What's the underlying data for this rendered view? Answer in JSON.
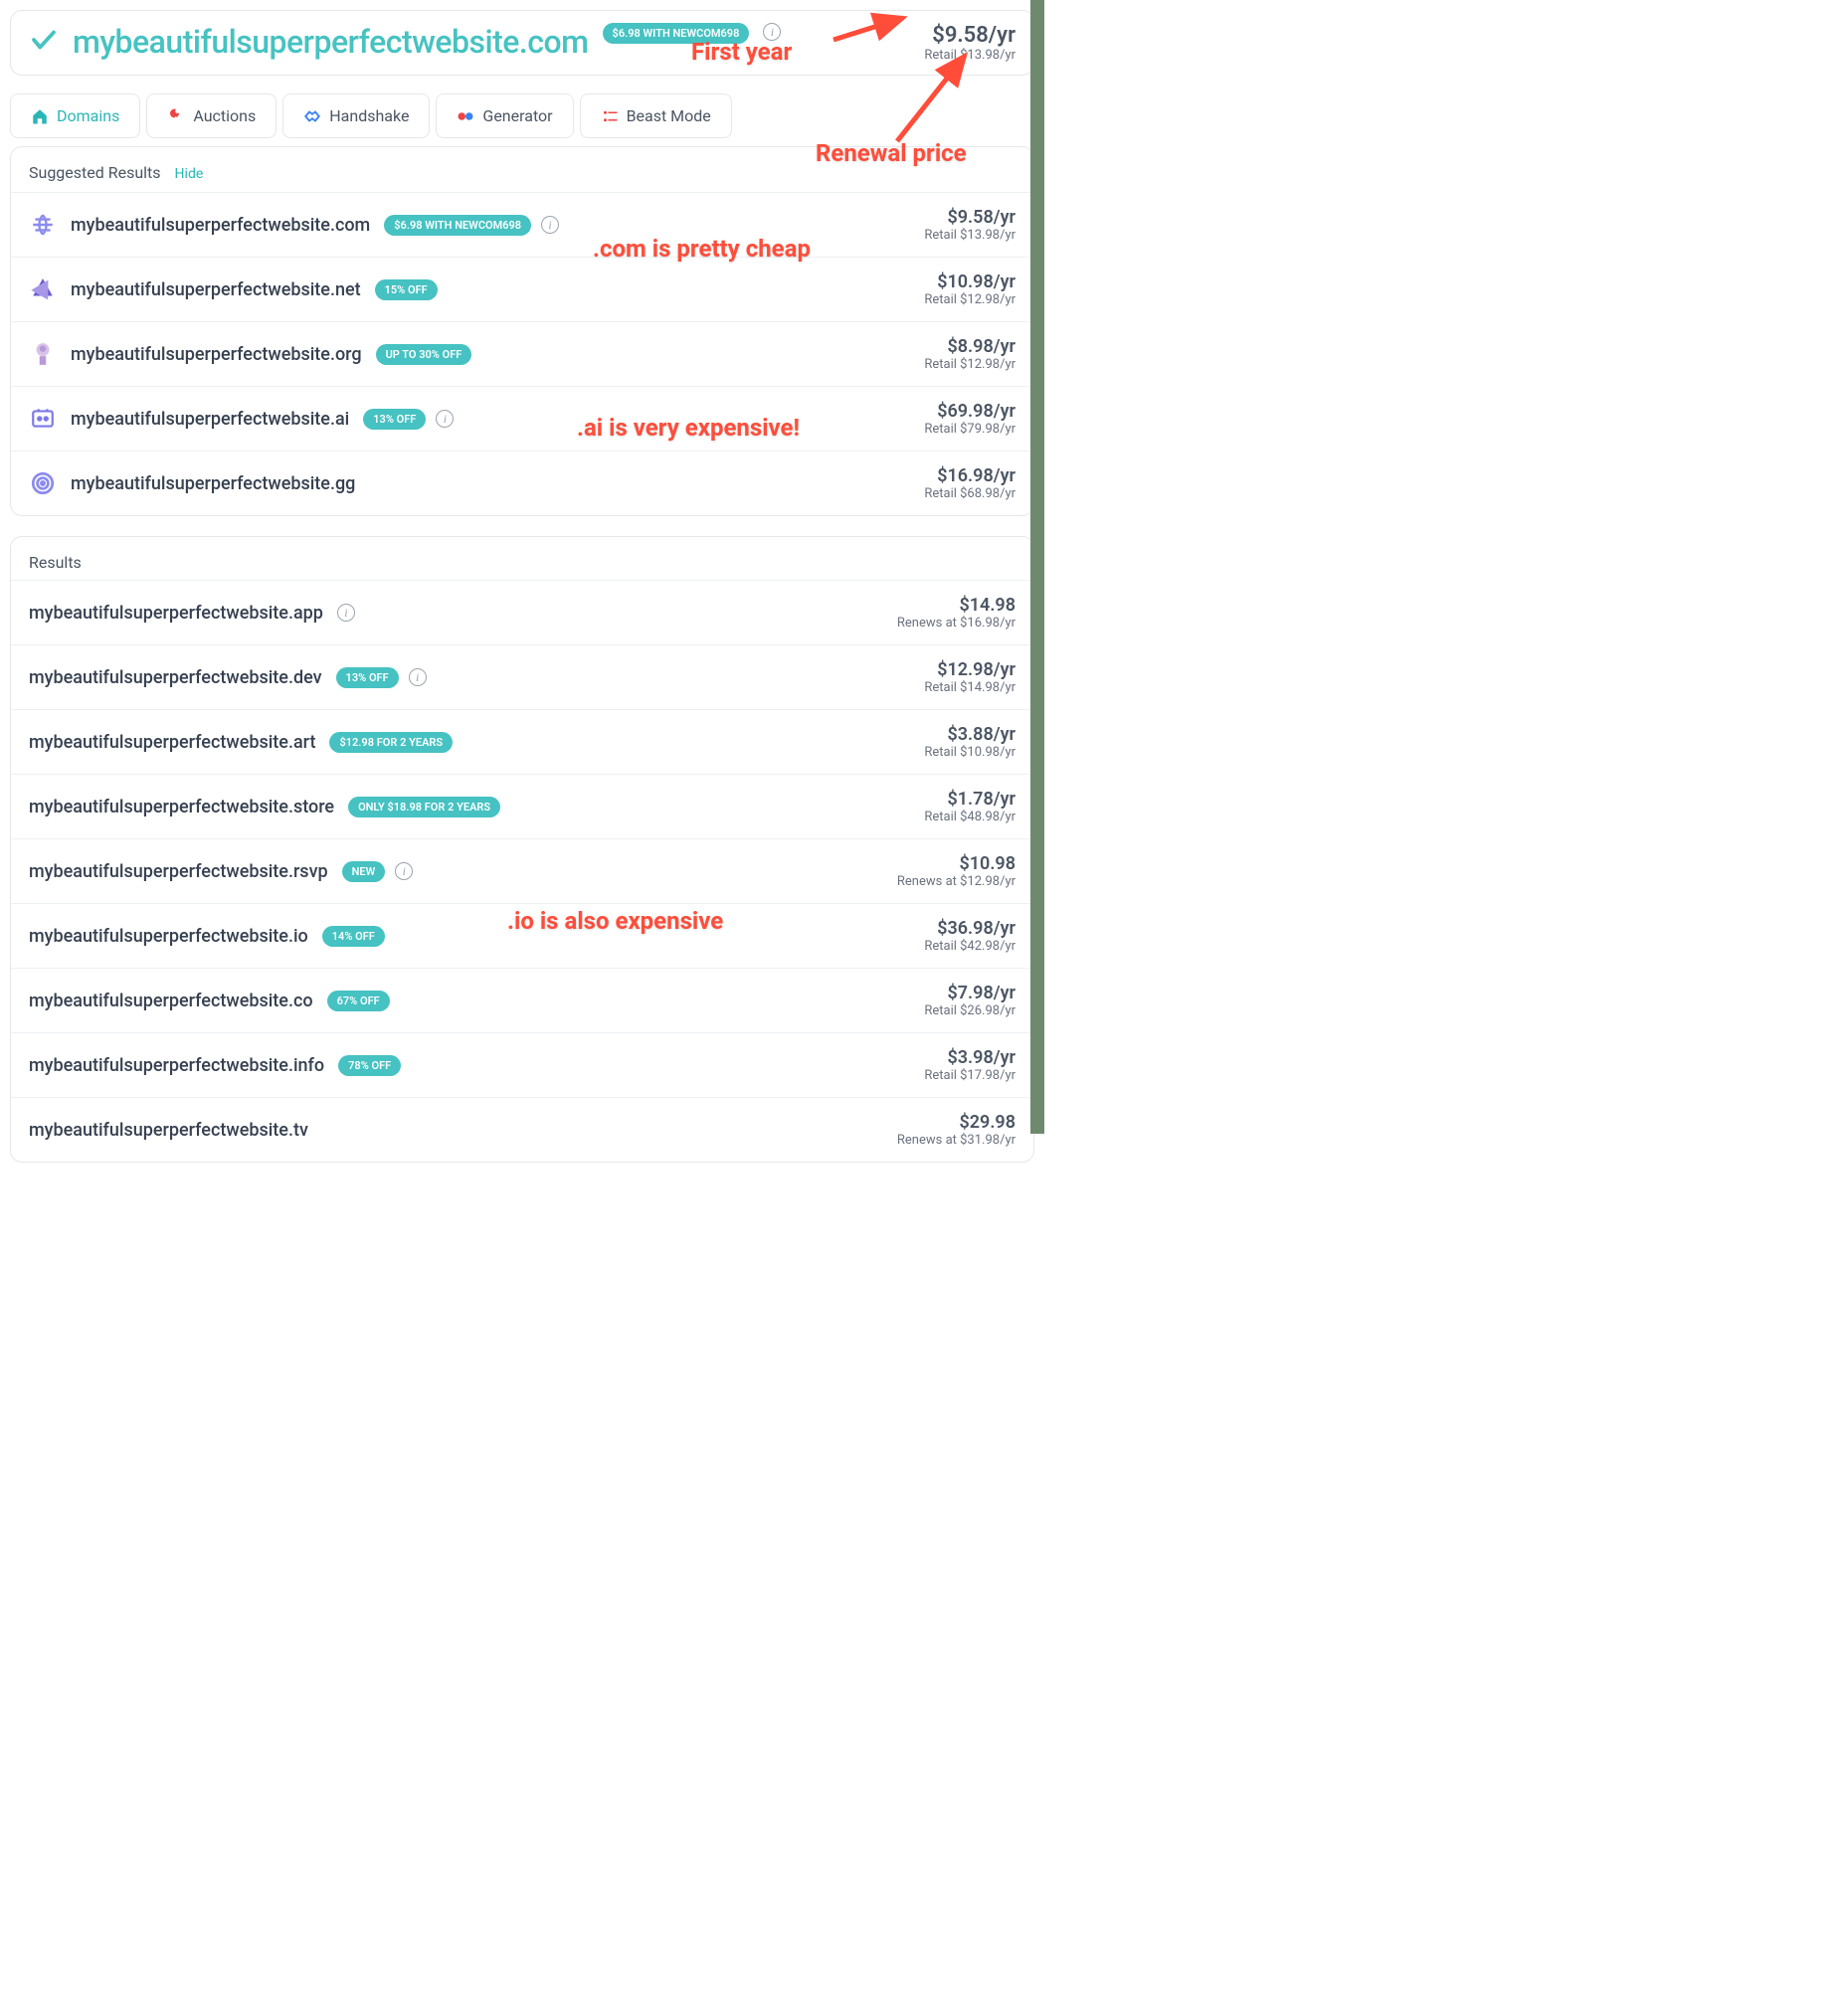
{
  "header": {
    "domain": "mybeautifulsuperperfectwebsite.com",
    "promo": "$6.98 WITH NEWCOM698",
    "price": "$9.58/yr",
    "retail": "Retail $13.98/yr"
  },
  "tabs": [
    {
      "label": "Domains",
      "icon": "house",
      "active": true
    },
    {
      "label": "Auctions",
      "icon": "gavel",
      "active": false
    },
    {
      "label": "Handshake",
      "icon": "handshake",
      "active": false
    },
    {
      "label": "Generator",
      "icon": "generator",
      "active": false
    },
    {
      "label": "Beast Mode",
      "icon": "beast",
      "active": false
    }
  ],
  "suggested": {
    "title": "Suggested Results",
    "hide_label": "Hide",
    "items": [
      {
        "icon": "globe",
        "domain": "mybeautifulsuperperfectwebsite.com",
        "badge": "$6.98 WITH NEWCOM698",
        "info": true,
        "price": "$9.58/yr",
        "retail": "Retail $13.98/yr"
      },
      {
        "icon": "net",
        "domain": "mybeautifulsuperperfectwebsite.net",
        "badge": "15% OFF",
        "info": false,
        "price": "$10.98/yr",
        "retail": "Retail $12.98/yr"
      },
      {
        "icon": "org",
        "domain": "mybeautifulsuperperfectwebsite.org",
        "badge": "UP TO 30% OFF",
        "info": false,
        "price": "$8.98/yr",
        "retail": "Retail $12.98/yr"
      },
      {
        "icon": "ai",
        "domain": "mybeautifulsuperperfectwebsite.ai",
        "badge": "13% OFF",
        "info": true,
        "price": "$69.98/yr",
        "retail": "Retail $79.98/yr"
      },
      {
        "icon": "gg",
        "domain": "mybeautifulsuperperfectwebsite.gg",
        "badge": "",
        "info": false,
        "price": "$16.98/yr",
        "retail": "Retail $68.98/yr"
      }
    ]
  },
  "results": {
    "title": "Results",
    "items": [
      {
        "domain": "mybeautifulsuperperfectwebsite.app",
        "badge": "",
        "info": true,
        "price": "$14.98",
        "retail": "Renews at $16.98/yr"
      },
      {
        "domain": "mybeautifulsuperperfectwebsite.dev",
        "badge": "13% OFF",
        "info": true,
        "price": "$12.98/yr",
        "retail": "Retail $14.98/yr"
      },
      {
        "domain": "mybeautifulsuperperfectwebsite.art",
        "badge": "$12.98 FOR 2 YEARS",
        "info": false,
        "price": "$3.88/yr",
        "retail": "Retail $10.98/yr"
      },
      {
        "domain": "mybeautifulsuperperfectwebsite.store",
        "badge": "ONLY $18.98 FOR 2 YEARS",
        "info": false,
        "price": "$1.78/yr",
        "retail": "Retail $48.98/yr"
      },
      {
        "domain": "mybeautifulsuperperfectwebsite.rsvp",
        "badge": "NEW",
        "info": true,
        "price": "$10.98",
        "retail": "Renews at $12.98/yr"
      },
      {
        "domain": "mybeautifulsuperperfectwebsite.io",
        "badge": "14% OFF",
        "info": false,
        "price": "$36.98/yr",
        "retail": "Retail $42.98/yr"
      },
      {
        "domain": "mybeautifulsuperperfectwebsite.co",
        "badge": "67% OFF",
        "info": false,
        "price": "$7.98/yr",
        "retail": "Retail $26.98/yr"
      },
      {
        "domain": "mybeautifulsuperperfectwebsite.info",
        "badge": "78% OFF",
        "info": false,
        "price": "$3.98/yr",
        "retail": "Retail $17.98/yr"
      },
      {
        "domain": "mybeautifulsuperperfectwebsite.tv",
        "badge": "",
        "info": false,
        "price": "$29.98",
        "retail": "Renews at $31.98/yr"
      }
    ]
  },
  "annotations": {
    "first_year": "First year",
    "renewal": "Renewal price",
    "com_cheap": ".com is pretty cheap",
    "ai_expensive": ".ai is very expensive!",
    "io_expensive": ".io is also expensive"
  }
}
